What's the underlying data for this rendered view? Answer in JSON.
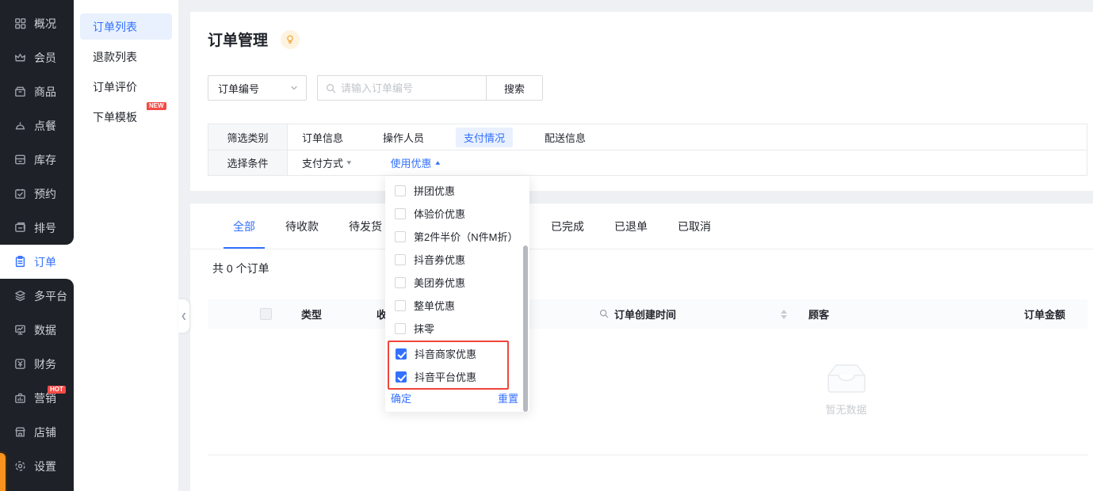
{
  "colors": {
    "accent": "#3370ff",
    "danger": "#f54a45",
    "sidebar_bg": "#1e2128",
    "highlight_red_border": "#f0453a"
  },
  "sidebar": {
    "items": [
      {
        "label": "概况"
      },
      {
        "label": "会员"
      },
      {
        "label": "商品"
      },
      {
        "label": "点餐"
      },
      {
        "label": "库存"
      },
      {
        "label": "预约"
      },
      {
        "label": "排号"
      },
      {
        "label": "订单"
      },
      {
        "label": "多平台"
      },
      {
        "label": "数据"
      },
      {
        "label": "财务"
      },
      {
        "label": "营销",
        "badge": "HOT"
      },
      {
        "label": "店铺"
      },
      {
        "label": "设置"
      }
    ]
  },
  "submenu": {
    "items": [
      {
        "label": "订单列表"
      },
      {
        "label": "退款列表"
      },
      {
        "label": "订单评价"
      },
      {
        "label": "下单模板",
        "badge": "NEW"
      }
    ]
  },
  "page": {
    "title": "订单管理"
  },
  "search": {
    "select_value": "订单编号",
    "placeholder": "请输入订单编号",
    "button": "搜索"
  },
  "filter": {
    "row1_label": "筛选类别",
    "categories": [
      "订单信息",
      "操作人员",
      "支付情况",
      "配送信息"
    ],
    "active_category": "支付情况",
    "row2_label": "选择条件",
    "conditions": [
      {
        "label": "支付方式"
      },
      {
        "label": "使用优惠"
      }
    ]
  },
  "dropdown": {
    "options": [
      {
        "label": "拼团优惠",
        "checked": false
      },
      {
        "label": "体验价优惠",
        "checked": false
      },
      {
        "label": "第2件半价（N件M折）",
        "checked": false
      },
      {
        "label": "抖音券优惠",
        "checked": false
      },
      {
        "label": "美团券优惠",
        "checked": false
      },
      {
        "label": "整单优惠",
        "checked": false
      },
      {
        "label": "抹零",
        "checked": false
      },
      {
        "label": "抖音商家优惠",
        "checked": true
      },
      {
        "label": "抖音平台优惠",
        "checked": true
      }
    ],
    "confirm": "确定",
    "reset": "重置"
  },
  "tabs": [
    "全部",
    "待收款",
    "待发货",
    "已完成",
    "已退单",
    "已取消"
  ],
  "active_tab": "全部",
  "orders": {
    "count_text": "共 0 个订单"
  },
  "table": {
    "headers": [
      "类型",
      "收",
      "订单创建时间",
      "顾客",
      "订单金额"
    ]
  },
  "empty": {
    "text": "暂无数据"
  }
}
